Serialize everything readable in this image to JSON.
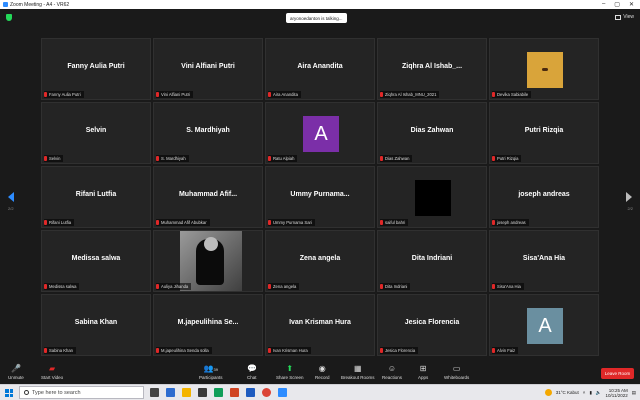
{
  "window": {
    "title": "Zoom Meeting - A4 - VR62"
  },
  "meeting": {
    "talking": "aryonoedanton is talking...",
    "view_label": "View"
  },
  "gallery": {
    "page_left": "2/2",
    "page_right": "2/2",
    "tiles": [
      {
        "name": "Fanny Aulia Putri",
        "label": "Fanny Aulia Putri"
      },
      {
        "name": "Vini Alfiani Putri",
        "label": "Vini Alfiani Putri"
      },
      {
        "name": "Aira Anandita",
        "label": "Aira Anandita"
      },
      {
        "name": "Ziqhra  Al Ishab_...",
        "label": "Ziqhra Al Ishab_MNU_2021"
      },
      {
        "name": "",
        "label": "Devika Sabiabile",
        "avatar_color": "#d9a43a"
      },
      {
        "name": "Selvin",
        "label": "Selvin"
      },
      {
        "name": "S. Mardhiyah",
        "label": "S. Mardhiyah"
      },
      {
        "name": "",
        "label": "Ratu Alpiah",
        "avatar_letter": "A",
        "avatar_color": "#7b2fa8"
      },
      {
        "name": "Dias Zahwan",
        "label": "Dias Zahwan"
      },
      {
        "name": "Putri Rizqia",
        "label": "Putri Rizqia"
      },
      {
        "name": "Rifani Lutfia",
        "label": "Rifani Lutfia"
      },
      {
        "name": "Muhammad  Afif...",
        "label": "Muhammad Afif Abubkar"
      },
      {
        "name": "Ummy  Purnama...",
        "label": "Ummy Purnama Sari"
      },
      {
        "name": "",
        "label": "saiful bahri",
        "avatar_color": "#000000"
      },
      {
        "name": "joseph andreas",
        "label": "joseph andreas"
      },
      {
        "name": "Medissa salwa",
        "label": "Medissa salwa"
      },
      {
        "name": "",
        "label": "Auliya Jihanda"
      },
      {
        "name": "Zena angela",
        "label": "Zena angela"
      },
      {
        "name": "Dita Indriani",
        "label": "Dita Indriani"
      },
      {
        "name": "Sisa'Ana Hia",
        "label": "Sisa'Ana Hia"
      },
      {
        "name": "Sabina Khan",
        "label": "Sabina Khan"
      },
      {
        "name": "M.japeulihina  Se...",
        "label": "M.japeulihina Senda solla"
      },
      {
        "name": "Ivan Krisman Hura",
        "label": "Ivan Krisman Hura"
      },
      {
        "name": "Jesica Florencia",
        "label": "Jesica Florencia"
      },
      {
        "name": "",
        "label": "Alvin Faiz",
        "avatar_letter": "A",
        "avatar_color": "#6a8fa0"
      }
    ]
  },
  "toolbar": {
    "unmute": "Unmute",
    "start_video": "Start Video",
    "participants": "Participants",
    "participants_count": "39",
    "chat": "Chat",
    "share_screen": "Share Screen",
    "record": "Record",
    "breakout": "Breakout Rooms",
    "reactions": "Reactions",
    "apps": "Apps",
    "whiteboards": "Whiteboards",
    "leave": "Leave Room"
  },
  "taskbar": {
    "search_placeholder": "Type here to search",
    "weather": "31°C  Kabut",
    "time": "10:25 AM",
    "date": "10/11/2022"
  }
}
